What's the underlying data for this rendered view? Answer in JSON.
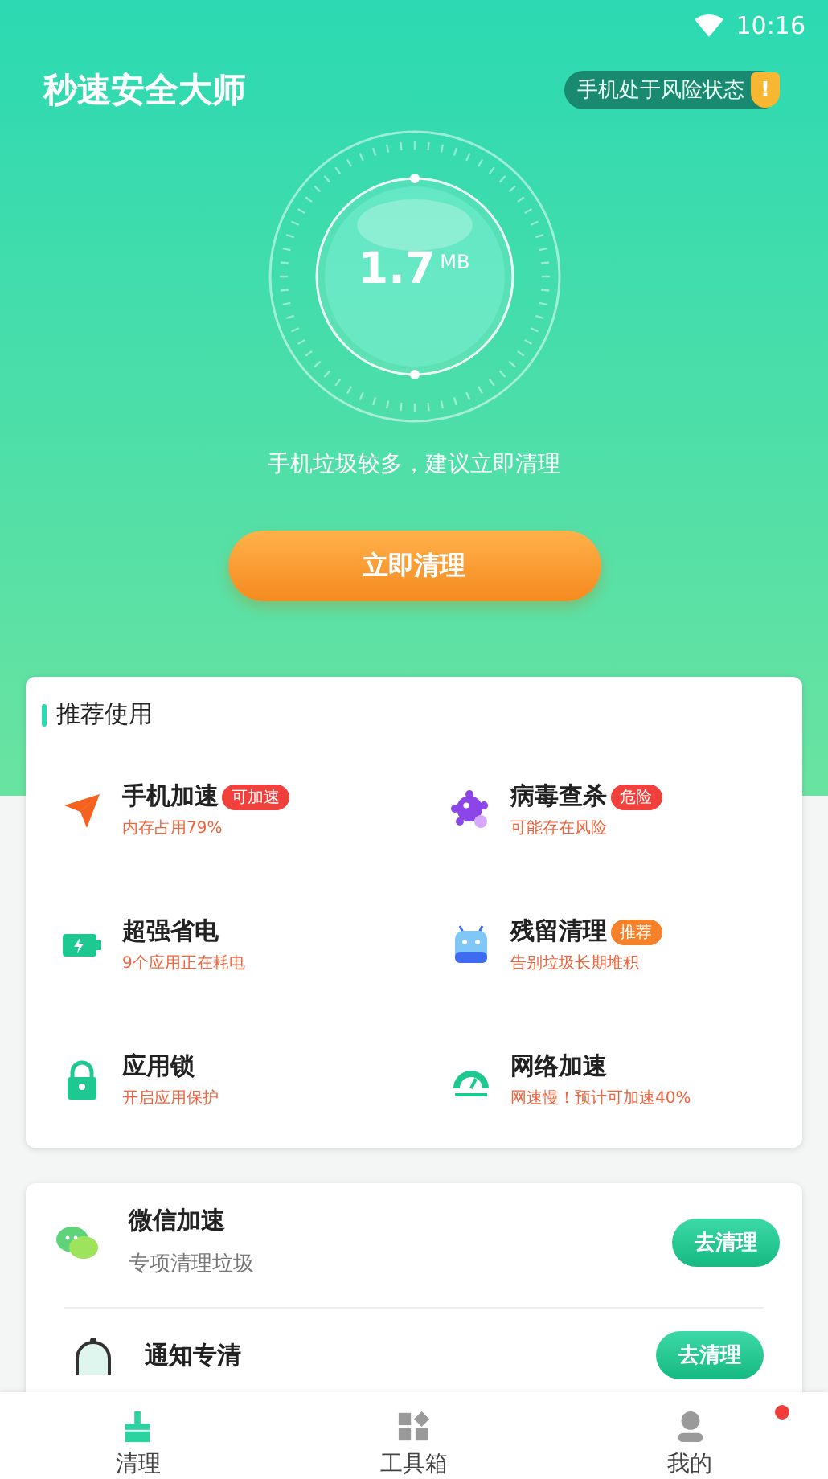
{
  "status_bar": {
    "time": "10:16"
  },
  "header": {
    "title": "秒速安全大师",
    "risk_badge": "手机处于风险状态",
    "risk_mark": "!"
  },
  "gauge": {
    "value": "1.7",
    "unit": "MB"
  },
  "hint": "手机垃圾较多，建议立即清理",
  "clean_button": "立即清理",
  "recommend": {
    "title": "推荐使用",
    "items": [
      {
        "kind": "plane",
        "title": "手机加速",
        "subtitle": "内存占用79%",
        "badge": {
          "text": "可加速",
          "color": "#f2403c"
        }
      },
      {
        "kind": "virus",
        "title": "病毒查杀",
        "subtitle": "可能存在风险",
        "badge": {
          "text": "危险",
          "color": "#f2403c"
        }
      },
      {
        "kind": "battery",
        "title": "超强省电",
        "subtitle": "9个应用正在耗电"
      },
      {
        "kind": "robot",
        "title": "残留清理",
        "subtitle": "告别垃圾长期堆积",
        "badge": {
          "text": "推荐",
          "color": "#f5822a"
        }
      },
      {
        "kind": "lock",
        "title": "应用锁",
        "subtitle": "开启应用保护"
      },
      {
        "kind": "speed",
        "title": "网络加速",
        "subtitle": "网速慢！预计可加速40%"
      }
    ]
  },
  "tools": [
    {
      "kind": "chat",
      "title": "微信加速",
      "subtitle": "专项清理垃圾",
      "button": "去清理"
    },
    {
      "kind": "bell",
      "title": "通知专清",
      "button": "去清理"
    }
  ],
  "tabs": [
    {
      "kind": "broom",
      "label": "清理",
      "selected": true,
      "notification": false
    },
    {
      "kind": "grid",
      "label": "工具箱",
      "selected": false,
      "notification": false
    },
    {
      "kind": "person",
      "label": "我的",
      "selected": false,
      "notification": true
    }
  ]
}
